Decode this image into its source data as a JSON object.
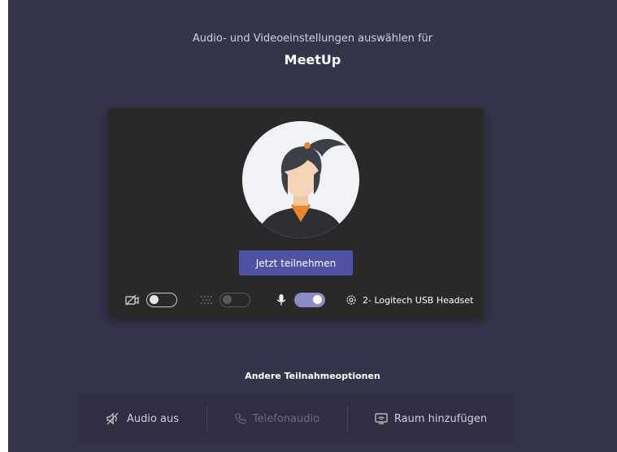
{
  "header": {
    "subtitle": "Audio- und Videoeinstellungen auswählen für",
    "meeting_name": "MeetUp"
  },
  "preview": {
    "join_button": "Jetzt teilnehmen",
    "controls": {
      "camera": {
        "icon": "camera-off-icon",
        "state": "off"
      },
      "blur": {
        "icon": "background-blur-icon",
        "state": "off",
        "enabled": false
      },
      "microphone": {
        "icon": "microphone-icon",
        "state": "on"
      },
      "device": {
        "icon": "gear-icon",
        "label": "2- Logitech USB Headset"
      }
    }
  },
  "other_options": {
    "heading": "Andere Teilnahmeoptionen",
    "items": [
      {
        "icon": "speaker-off-icon",
        "label": "Audio aus",
        "enabled": true
      },
      {
        "icon": "phone-icon",
        "label": "Telefonaudio",
        "enabled": false
      },
      {
        "icon": "cast-icon",
        "label": "Raum hinzufügen",
        "enabled": true
      }
    ]
  },
  "colors": {
    "background": "#34344a",
    "preview_background": "#2a2929",
    "accent": "#4f52a2",
    "toggle_on": "#8b8cc7"
  }
}
